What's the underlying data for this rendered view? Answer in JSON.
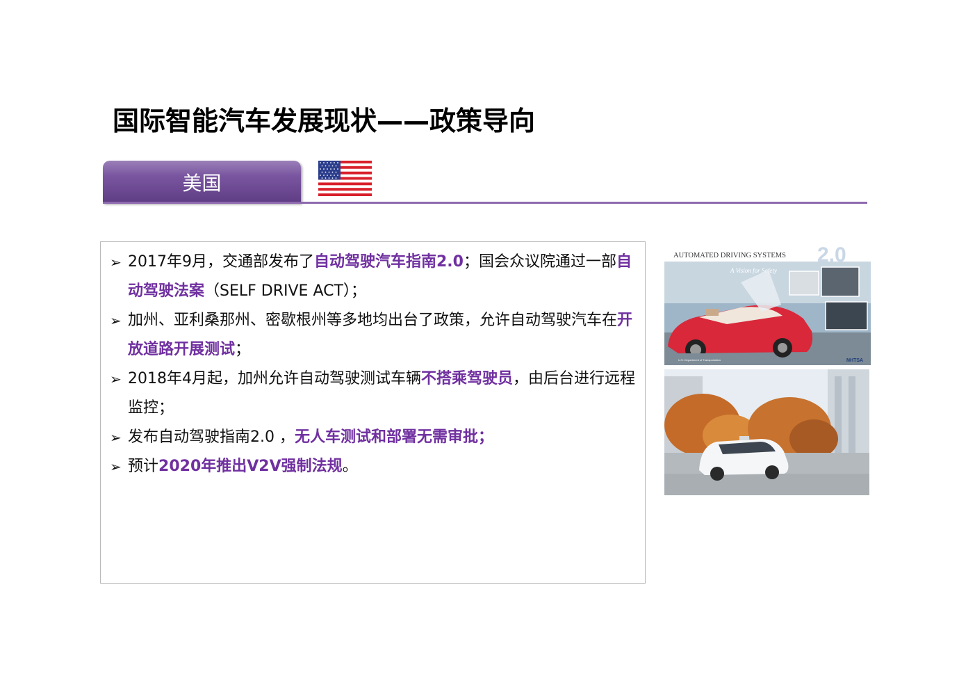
{
  "title": "国际智能汽车发展现状——政策导向",
  "tab": {
    "label": "美国"
  },
  "bullets": [
    {
      "parts": [
        {
          "t": "2017年9月，交通部发布了",
          "h": false
        },
        {
          "t": "自动驾驶汽车指南2.0",
          "h": true
        },
        {
          "t": "；国会众议院通过一部",
          "h": false
        },
        {
          "t": "自动驾驶法案",
          "h": true
        },
        {
          "t": "（SELF DRIVE ACT）；",
          "h": false
        }
      ]
    },
    {
      "parts": [
        {
          "t": "加州、亚利桑那州、密歇根州等多地均出台了政策，允许自动驾驶汽车在",
          "h": false
        },
        {
          "t": "开放道路开展测试",
          "h": true
        },
        {
          "t": "；",
          "h": false
        }
      ]
    },
    {
      "parts": [
        {
          "t": "2018年4月起，加州允许自动驾驶测试车辆",
          "h": false
        },
        {
          "t": "不搭乘驾驶员",
          "h": true
        },
        {
          "t": "，由后台进行远程监控；",
          "h": false
        }
      ]
    },
    {
      "parts": [
        {
          "t": "发布自动驾驶指南2.0 ，",
          "h": false
        },
        {
          "t": "无人车测试和部署无需审批；",
          "h": true
        }
      ]
    },
    {
      "parts": [
        {
          "t": "预计",
          "h": false
        },
        {
          "t": "2020年推出V2V强制法规",
          "h": true
        },
        {
          "t": "。",
          "h": false
        }
      ]
    }
  ],
  "image1": {
    "heading": "AUTOMATED DRIVING SYSTEMS",
    "version": "2.0",
    "subtitle": "A Vision for Safety",
    "footer_left": "U.S. Department of Transportation",
    "footer_right": "NHTSA"
  },
  "colors": {
    "accent": "#7030a0",
    "tab": "#6a4a92"
  }
}
